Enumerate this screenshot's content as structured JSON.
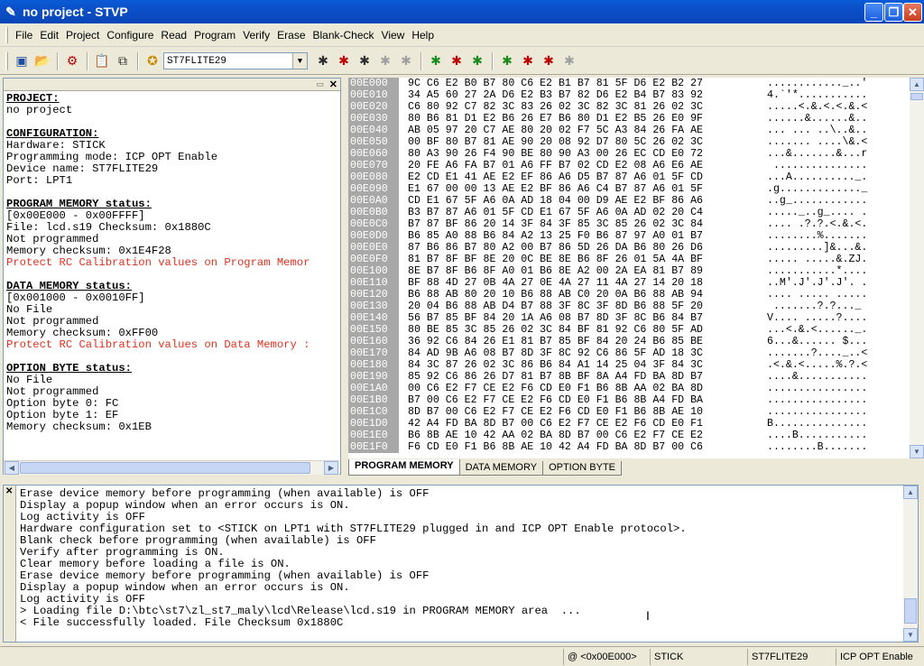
{
  "window": {
    "title": "no project - STVP"
  },
  "menu": [
    "File",
    "Edit",
    "Project",
    "Configure",
    "Read",
    "Program",
    "Verify",
    "Erase",
    "Blank-Check",
    "View",
    "Help"
  ],
  "toolbar": {
    "device_select": "ST7FLITE29"
  },
  "project_info": {
    "project_header": "PROJECT:",
    "project_value": "no project",
    "config_header": "CONFIGURATION:",
    "hardware": "Hardware: STICK",
    "prog_mode": "Programming mode: ICP OPT Enable",
    "device_name": "Device name: ST7FLITE29",
    "port": "Port: LPT1",
    "prog_mem_header": "PROGRAM MEMORY status:",
    "prog_mem_range": "[0x00E000 - 0x00FFFF]",
    "prog_mem_file": "File: lcd.s19 Checksum: 0x1880C",
    "prog_mem_state": "Not programmed",
    "prog_mem_checksum": "Memory checksum: 0x1E4F28",
    "prog_mem_warning": "Protect RC Calibration values on Program Memor",
    "data_mem_header": "DATA MEMORY status:",
    "data_mem_range": "[0x001000 - 0x0010FF]",
    "data_mem_file": "No File",
    "data_mem_state": "Not programmed",
    "data_mem_checksum": "Memory checksum: 0xFF00",
    "data_mem_warning": "Protect RC Calibration values on Data Memory :",
    "opt_header": "OPTION BYTE status:",
    "opt_file": "No File",
    "opt_state": "Not programmed",
    "opt_byte0": "Option byte 0: FC",
    "opt_byte1": "Option byte 1: EF",
    "opt_checksum": "Memory checksum: 0x1EB"
  },
  "hex_rows": [
    {
      "addr": "00E000",
      "bytes": "9C C6 E2 B0 B7 80 C6 E2 B1 B7 81 5F D6 E2 B2 27",
      "ascii": "............_..'"
    },
    {
      "addr": "00E010",
      "bytes": "34 A5 60 27 2A D6 E2 B3 B7 82 D6 E2 B4 B7 83 92",
      "ascii": "4.`'*..........."
    },
    {
      "addr": "00E020",
      "bytes": "C6 80 92 C7 82 3C 83 26 02 3C 82 3C 81 26 02 3C",
      "ascii": ".....<.&.<.<.&.<"
    },
    {
      "addr": "00E030",
      "bytes": "80 B6 81 D1 E2 B6 26 E7 B6 80 D1 E2 B5 26 E0 9F",
      "ascii": "......&......&.."
    },
    {
      "addr": "00E040",
      "bytes": "AB 05 97 20 C7 AE 80 20 02 F7 5C A3 84 26 FA AE",
      "ascii": "... ... ..\\..&.."
    },
    {
      "addr": "00E050",
      "bytes": "00 BF 80 B7 81 AE 90 20 08 92 D7 80 5C 26 02 3C",
      "ascii": "....... ....\\&.<"
    },
    {
      "addr": "00E060",
      "bytes": "80 A3 90 26 F4 90 BE 80 90 A3 00 26 EC CD E0 72",
      "ascii": "...&.......&...r"
    },
    {
      "addr": "00E070",
      "bytes": "20 FE A6 FA B7 01 A6 FF B7 02 CD E2 08 A6 E6 AE",
      "ascii": " ..............."
    },
    {
      "addr": "00E080",
      "bytes": "E2 CD E1 41 AE E2 EF 86 A6 D5 B7 87 A6 01 5F CD",
      "ascii": "...A.........._."
    },
    {
      "addr": "00E090",
      "bytes": "E1 67 00 00 13 AE E2 BF 86 A6 C4 B7 87 A6 01 5F",
      "ascii": ".g............._"
    },
    {
      "addr": "00E0A0",
      "bytes": "CD E1 67 5F A6 0A AD 18 04 00 D9 AE E2 BF 86 A6",
      "ascii": "..g_............"
    },
    {
      "addr": "00E0B0",
      "bytes": "B3 B7 87 A6 01 5F CD E1 67 5F A6 0A AD 02 20 C4",
      "ascii": "....._..g_.... ."
    },
    {
      "addr": "00E0C0",
      "bytes": "B7 87 BF 86 20 14 3F 84 3F 85 3C 85 26 02 3C 84",
      "ascii": ".... .?.?.<.&.<."
    },
    {
      "addr": "00E0D0",
      "bytes": "B6 85 A0 88 B6 84 A2 13 25 F0 B6 87 97 A0 01 B7",
      "ascii": "........%......."
    },
    {
      "addr": "00E0E0",
      "bytes": "87 B6 86 B7 80 A2 00 B7 86 5D 26 DA B6 80 26 D6",
      "ascii": ".........]&...&."
    },
    {
      "addr": "00E0F0",
      "bytes": "81 B7 8F BF 8E 20 0C BE 8E B6 8F 26 01 5A 4A BF",
      "ascii": "..... .....&.ZJ."
    },
    {
      "addr": "00E100",
      "bytes": "8E B7 8F B6 8F A0 01 B6 8E A2 00 2A EA 81 B7 89",
      "ascii": "...........*...."
    },
    {
      "addr": "00E110",
      "bytes": "BF 88 4D 27 0B 4A 27 0E 4A 27 11 4A 27 14 20 18",
      "ascii": "..M'.J'.J'.J'. ."
    },
    {
      "addr": "00E120",
      "bytes": "B6 88 AB 80 20 10 B6 88 AB C0 20 0A B6 88 AB 94",
      "ascii": ".... ..... ....."
    },
    {
      "addr": "00E130",
      "bytes": "20 04 B6 88 AB D4 B7 88 3F 8C 3F 8D B6 88 5F 20",
      "ascii": " .......?.?..._ "
    },
    {
      "addr": "00E140",
      "bytes": "56 B7 85 BF 84 20 1A A6 08 B7 8D 3F 8C B6 84 B7",
      "ascii": "V.... .....?...."
    },
    {
      "addr": "00E150",
      "bytes": "80 BE 85 3C 85 26 02 3C 84 BF 81 92 C6 80 5F AD",
      "ascii": "...<.&.<......_."
    },
    {
      "addr": "00E160",
      "bytes": "36 92 C6 84 26 E1 81 B7 85 BF 84 20 24 B6 85 BE",
      "ascii": "6...&...... $..."
    },
    {
      "addr": "00E170",
      "bytes": "84 AD 9B A6 08 B7 8D 3F 8C 92 C6 86 5F AD 18 3C",
      "ascii": ".......?...._..<"
    },
    {
      "addr": "00E180",
      "bytes": "84 3C 87 26 02 3C 86 B6 84 A1 14 25 04 3F 84 3C",
      "ascii": ".<.&.<.....%.?.<"
    },
    {
      "addr": "00E190",
      "bytes": "85 92 C6 86 26 D7 81 B7 8B BF 8A A4 FD BA 8D B7",
      "ascii": "....&..........."
    },
    {
      "addr": "00E1A0",
      "bytes": "00 C6 E2 F7 CE E2 F6 CD E0 F1 B6 8B AA 02 BA 8D",
      "ascii": "................"
    },
    {
      "addr": "00E1B0",
      "bytes": "B7 00 C6 E2 F7 CE E2 F6 CD E0 F1 B6 8B A4 FD BA",
      "ascii": "................"
    },
    {
      "addr": "00E1C0",
      "bytes": "8D B7 00 C6 E2 F7 CE E2 F6 CD E0 F1 B6 8B AE 10",
      "ascii": "................"
    },
    {
      "addr": "00E1D0",
      "bytes": "42 A4 FD BA 8D B7 00 C6 E2 F7 CE E2 F6 CD E0 F1",
      "ascii": "B..............."
    },
    {
      "addr": "00E1E0",
      "bytes": "B6 8B AE 10 42 AA 02 BA 8D B7 00 C6 E2 F7 CE E2",
      "ascii": "....B..........."
    },
    {
      "addr": "00E1F0",
      "bytes": "F6 CD E0 F1 B6 8B AE 10 42 A4 FD BA 8D B7 00 C6",
      "ascii": "........B......."
    }
  ],
  "tabs": [
    "PROGRAM MEMORY",
    "DATA MEMORY",
    "OPTION BYTE"
  ],
  "log_lines": [
    "Erase device memory before programming (when available) is OFF",
    "Display a popup window when an error occurs is ON.",
    "Log activity is OFF",
    "Hardware configuration set to <STICK on LPT1 with ST7FLITE29 plugged in and ICP OPT Enable protocol>.",
    "Blank check before programming (when available) is OFF",
    "Verify after programming is ON.",
    "Clear memory before loading a file is ON.",
    "Erase device memory before programming (when available) is OFF",
    "Display a popup window when an error occurs is ON.",
    "Log activity is OFF",
    "> Loading file D:\\btc\\st7\\zl_st7_maly\\lcd\\Release\\lcd.s19 in PROGRAM MEMORY area  ...",
    "< File successfully loaded. File Checksum 0x1880C"
  ],
  "status": {
    "address": "@ <0x00E000>",
    "hardware": "STICK",
    "device": "ST7FLITE29",
    "mode": "ICP OPT Enable"
  }
}
